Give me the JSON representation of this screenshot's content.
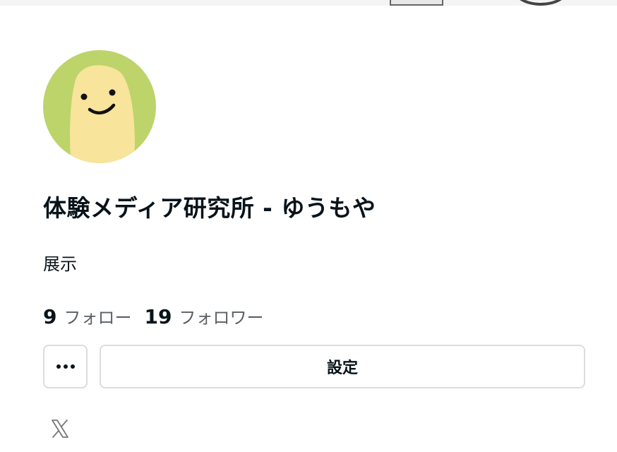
{
  "profile": {
    "name": "体験メディア研究所 - ゆうもや",
    "bio": "展示",
    "following_count": "9",
    "following_label": "フォロー",
    "followers_count": "19",
    "followers_label": "フォロワー"
  },
  "actions": {
    "more_icon": "ellipsis-icon",
    "settings_label": "設定"
  },
  "social": {
    "x_icon": "x-logo-icon"
  },
  "colors": {
    "avatar_bg": "#bcd46a",
    "avatar_face": "#f8e49a",
    "text": "#08131a",
    "muted": "#5a6066",
    "border": "#dcdcdc"
  }
}
